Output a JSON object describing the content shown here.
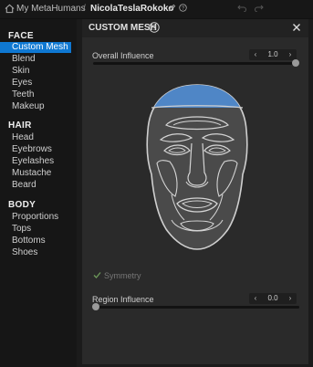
{
  "topbar": {
    "breadcrumb": "My MetaHumans",
    "separator": "/",
    "character_name": "NicolaTeslaRokoko"
  },
  "sidebar": {
    "face_title": "FACE",
    "face_items": [
      "Custom Mesh",
      "Blend",
      "Skin",
      "Eyes",
      "Teeth",
      "Makeup"
    ],
    "hair_title": "HAIR",
    "hair_items": [
      "Head",
      "Eyebrows",
      "Eyelashes",
      "Mustache",
      "Beard"
    ],
    "body_title": "BODY",
    "body_items": [
      "Proportions",
      "Tops",
      "Bottoms",
      "Shoes"
    ],
    "active_item": "Custom Mesh"
  },
  "panel": {
    "title": "CUSTOM MESH",
    "overall_influence_label": "Overall Influence",
    "overall_influence_value": "1.0",
    "symmetry_label": "Symmetry",
    "symmetry_checked": true,
    "region_influence_label": "Region Influence",
    "region_influence_value": "0.0"
  },
  "colors": {
    "accent": "#0f78d2",
    "highlight_region": "#4f86c6"
  },
  "icons": [
    "home-icon",
    "edit-icon",
    "help-icon",
    "undo-icon",
    "redo-icon",
    "close-icon",
    "chevron-left-icon",
    "chevron-right-icon",
    "check-icon"
  ]
}
